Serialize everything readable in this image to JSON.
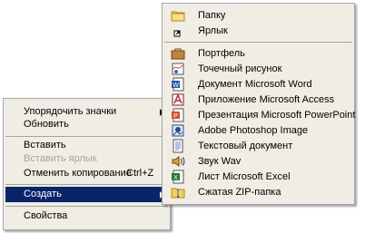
{
  "context_menu": {
    "arrange_icons": "Упорядочить значки",
    "refresh": "Обновить",
    "paste": "Вставить",
    "paste_shortcut": "Вставить ярлык",
    "undo_copy": "Отменить копирование",
    "undo_copy_shortcut": "Ctrl+Z",
    "new": "Создать",
    "properties": "Свойства"
  },
  "new_submenu": {
    "items": [
      {
        "label": "Папку",
        "icon": "folder-icon"
      },
      {
        "label": "Ярлык",
        "icon": "shortcut-icon"
      },
      {
        "label": "Портфель",
        "icon": "briefcase-icon"
      },
      {
        "label": "Точечный рисунок",
        "icon": "bitmap-icon"
      },
      {
        "label": "Документ Microsoft Word",
        "icon": "word-document-icon"
      },
      {
        "label": "Приложение Microsoft Access",
        "icon": "access-database-icon"
      },
      {
        "label": "Презентация Microsoft PowerPoint",
        "icon": "powerpoint-presentation-icon"
      },
      {
        "label": "Adobe Photoshop Image",
        "icon": "photoshop-image-icon"
      },
      {
        "label": "Текстовый документ",
        "icon": "text-document-icon"
      },
      {
        "label": "Звук Wav",
        "icon": "wave-sound-icon"
      },
      {
        "label": "Лист Microsoft Excel",
        "icon": "excel-sheet-icon"
      },
      {
        "label": "Сжатая ZIP-папка",
        "icon": "zip-folder-icon"
      }
    ]
  },
  "colors": {
    "menu_bg": "#efede4",
    "highlight": "#0a246a",
    "disabled_text": "#a6a49b"
  }
}
